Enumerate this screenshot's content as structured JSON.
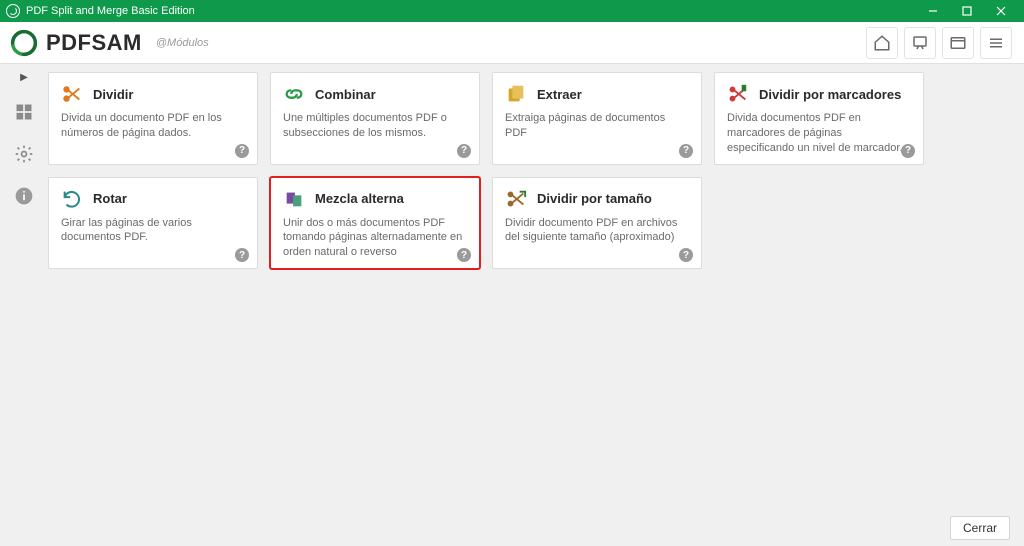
{
  "window": {
    "title": "PDF Split and Merge Basic Edition"
  },
  "header": {
    "logo_text": "PDFSAM",
    "breadcrumb": "@Módulos"
  },
  "cards": [
    {
      "title": "Dividir",
      "desc": "Divida un documento PDF en los números de página dados."
    },
    {
      "title": "Combinar",
      "desc": "Une múltiples documentos PDF o subsecciones de los mismos."
    },
    {
      "title": "Extraer",
      "desc": "Extraiga páginas de documentos PDF"
    },
    {
      "title": "Dividir por marcadores",
      "desc": "Divida documentos PDF en marcadores de páginas especificando un nivel de marcador."
    },
    {
      "title": "Rotar",
      "desc": "Girar las páginas de varios documentos PDF."
    },
    {
      "title": "Mezcla alterna",
      "desc": "Unir dos o más documentos PDF tomando páginas alternadamente en orden natural o reverso"
    },
    {
      "title": "Dividir por tamaño",
      "desc": "Dividir documento PDF en archivos del siguiente tamaño (aproximado)"
    }
  ],
  "footer": {
    "close": "Cerrar"
  }
}
